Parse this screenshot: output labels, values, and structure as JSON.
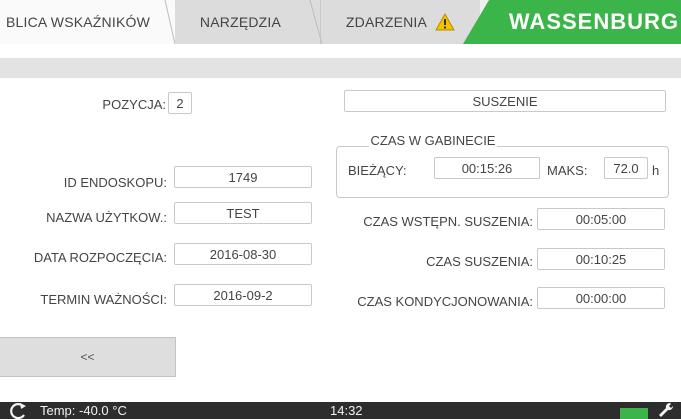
{
  "tabs": {
    "table": "BLICA WSKAŹNIKÓW",
    "tools": "NARZĘDZIA",
    "events": "ZDARZENIA"
  },
  "brand": {
    "name": "WASSENBURG"
  },
  "form": {
    "position_label": "POZYCJA:",
    "position_value": "2",
    "phase_value": "SUSZENIE",
    "cabinet_time_title": "CZAS W GABINECIE",
    "current_label": "BIEŻĄCY:",
    "current_value": "00:15:26",
    "max_label": "MAKS:",
    "max_value": "72.0",
    "max_unit": "h",
    "endoscope_id_label": "ID ENDOSKOPU:",
    "endoscope_id_value": "1749",
    "user_label": "NAZWA UŻYTKOW.:",
    "user_value": "TEST",
    "start_date_label": "DATA ROZPOCZĘCIA:",
    "start_date_value": "2016-08-30",
    "expiry_label": "TERMIN WAŻNOŚCI:",
    "expiry_value": "2016-09-2",
    "predry_label": "CZAS WSTĘPN. SUSZENIA:",
    "predry_value": "00:05:00",
    "dry_label": "CZAS SUSZENIA:",
    "dry_value": "00:10:25",
    "cond_label": "CZAS KONDYCJONOWANIA:",
    "cond_value": "00:00:00"
  },
  "buttons": {
    "back": "<<"
  },
  "status": {
    "temp": "Temp: -40.0 °C",
    "time": "14:32"
  },
  "colors": {
    "brand_green": "#3bb449",
    "warning_yellow": "#f2c200",
    "status_bg": "#2d2d2d"
  },
  "icons": {
    "warning": "warning-triangle-icon",
    "status_left": "refresh-icon",
    "settings": "wrench-icon"
  }
}
